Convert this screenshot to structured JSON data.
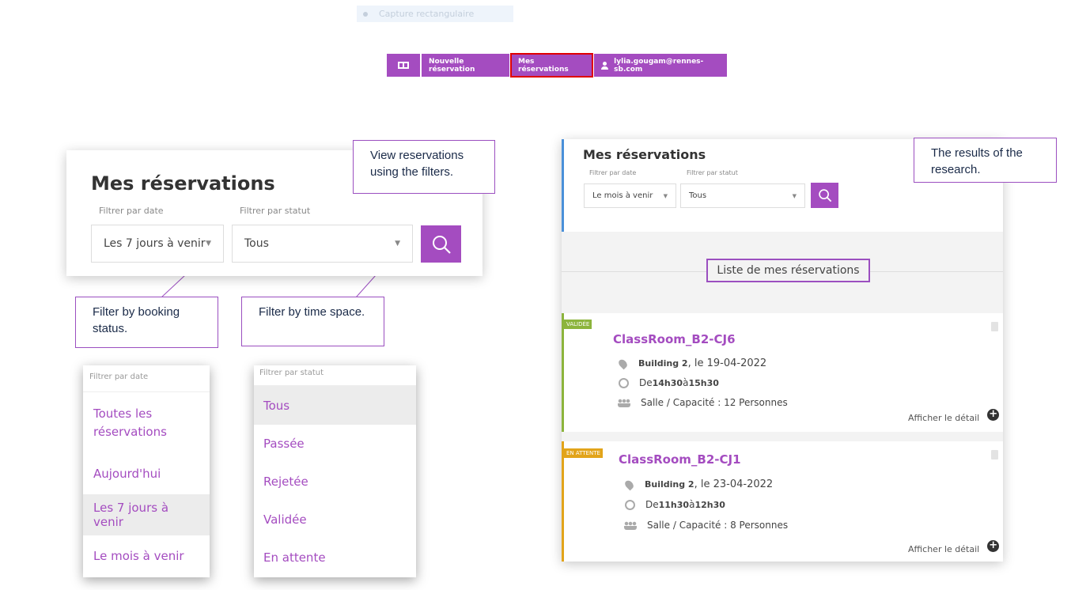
{
  "snip": {
    "label": "Capture rectangulaire"
  },
  "nav": {
    "new_booking": "Nouvelle réservation",
    "my_bookings": "Mes réservations",
    "user_email": "lylia.gougam@rennes-sb.com"
  },
  "filter_panel": {
    "title": "Mes réservations",
    "date_label": "Filtrer par date",
    "status_label": "Filtrer par statut",
    "date_value": "Les 7 jours à venir",
    "status_value": "Tous"
  },
  "notes": {
    "view": "View reservations using the filters.",
    "booking_status": "Filter by booking status.",
    "time_space": "Filter by time space.",
    "results": "The results of the research."
  },
  "date_dropdown": {
    "header": "Filtrer par date",
    "options": [
      "Toutes les réservations",
      "Aujourd'hui",
      "Les 7 jours à venir",
      "Le mois à venir"
    ],
    "selected": "Les 7 jours à venir"
  },
  "status_dropdown": {
    "header": "Filtrer par statut",
    "options": [
      "Tous",
      "Passée",
      "Rejetée",
      "Validée",
      "En attente"
    ],
    "selected": "Tous"
  },
  "results_panel": {
    "title": "Mes réservations",
    "date_label": "Filtrer par date",
    "status_label": "Filtrer par statut",
    "date_value": "Le mois à venir",
    "status_value": "Tous",
    "list_title": "Liste de mes réservations",
    "detail_link": "Afficher le détail",
    "reservations": [
      {
        "status": "VALIDÉE",
        "status_color": "#8cb43c",
        "room": "ClassRoom_B2-CJ6",
        "building": "Building 2",
        "date_text": ", le 19-04-2022",
        "from_word": "De ",
        "start": "14h30",
        "to_word": " à ",
        "end": "15h30",
        "capacity": "Salle / Capacité : 12 Personnes"
      },
      {
        "status": "EN ATTENTE",
        "status_color": "#e2a41a",
        "room": "ClassRoom_B2-CJ1",
        "building": "Building 2",
        "date_text": ", le 23-04-2022",
        "from_word": "De ",
        "start": "11h30",
        "to_word": " à ",
        "end": "12h30",
        "capacity": "Salle / Capacité : 8 Personnes"
      }
    ]
  },
  "colors": {
    "accent": "#a44cc0",
    "active_outline": "#e00000"
  }
}
